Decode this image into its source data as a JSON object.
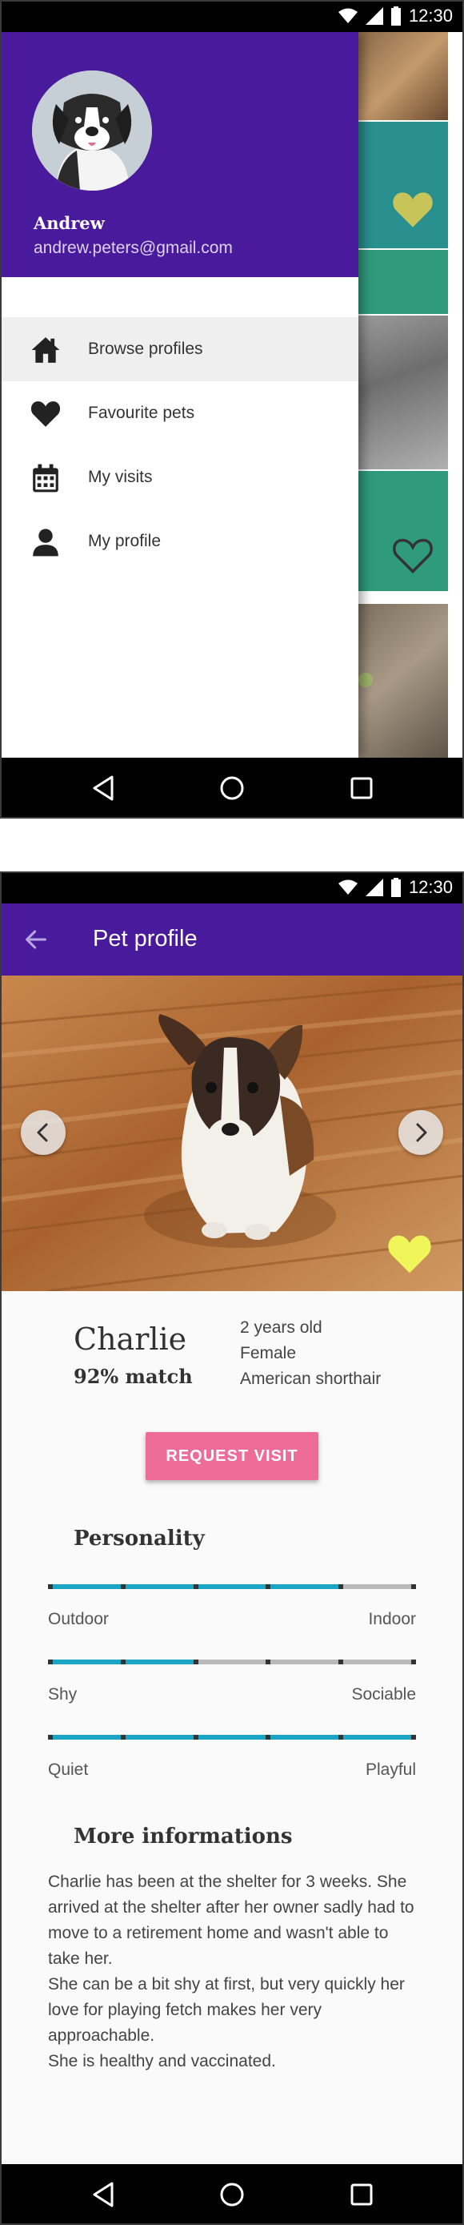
{
  "status_bar": {
    "time": "12:30"
  },
  "drawer": {
    "user_name": "Andrew",
    "user_email": "andrew.peters@gmail.com",
    "menu": [
      {
        "label": "Browse profiles",
        "icon": "home-icon",
        "active": true
      },
      {
        "label": "Favourite pets",
        "icon": "heart-icon",
        "active": false
      },
      {
        "label": "My visits",
        "icon": "calendar-icon",
        "active": false
      },
      {
        "label": "My profile",
        "icon": "person-icon",
        "active": false
      }
    ]
  },
  "pet_profile": {
    "title": "Pet profile",
    "name": "Charlie",
    "match": "92% match",
    "details": [
      "2 years old",
      "Female",
      "American shorthair"
    ],
    "request_button": "REQUEST VISIT",
    "personality_title": "Personality",
    "sliders": [
      {
        "left": "Outdoor",
        "right": "Indoor",
        "value": 0.8
      },
      {
        "left": "Shy",
        "right": "Sociable",
        "value": 0.4
      },
      {
        "left": "Quiet",
        "right": "Playful",
        "value": 1.0
      }
    ],
    "more_title": "More informations",
    "info_paragraphs": [
      "Charlie has been at the shelter for 3 weeks. She arrived at the shelter after her owner sadly had to move to a retirement home and wasn't able to take her.",
      "She can be a bit shy at first, but very quickly her love for playing fetch makes her very approachable.",
      "She is healthy and vaccinated."
    ]
  },
  "colors": {
    "primary": "#4a1a9c",
    "accent": "#ee6d98",
    "slider": "#1aa5c4",
    "favourite": "#f0f55a"
  }
}
